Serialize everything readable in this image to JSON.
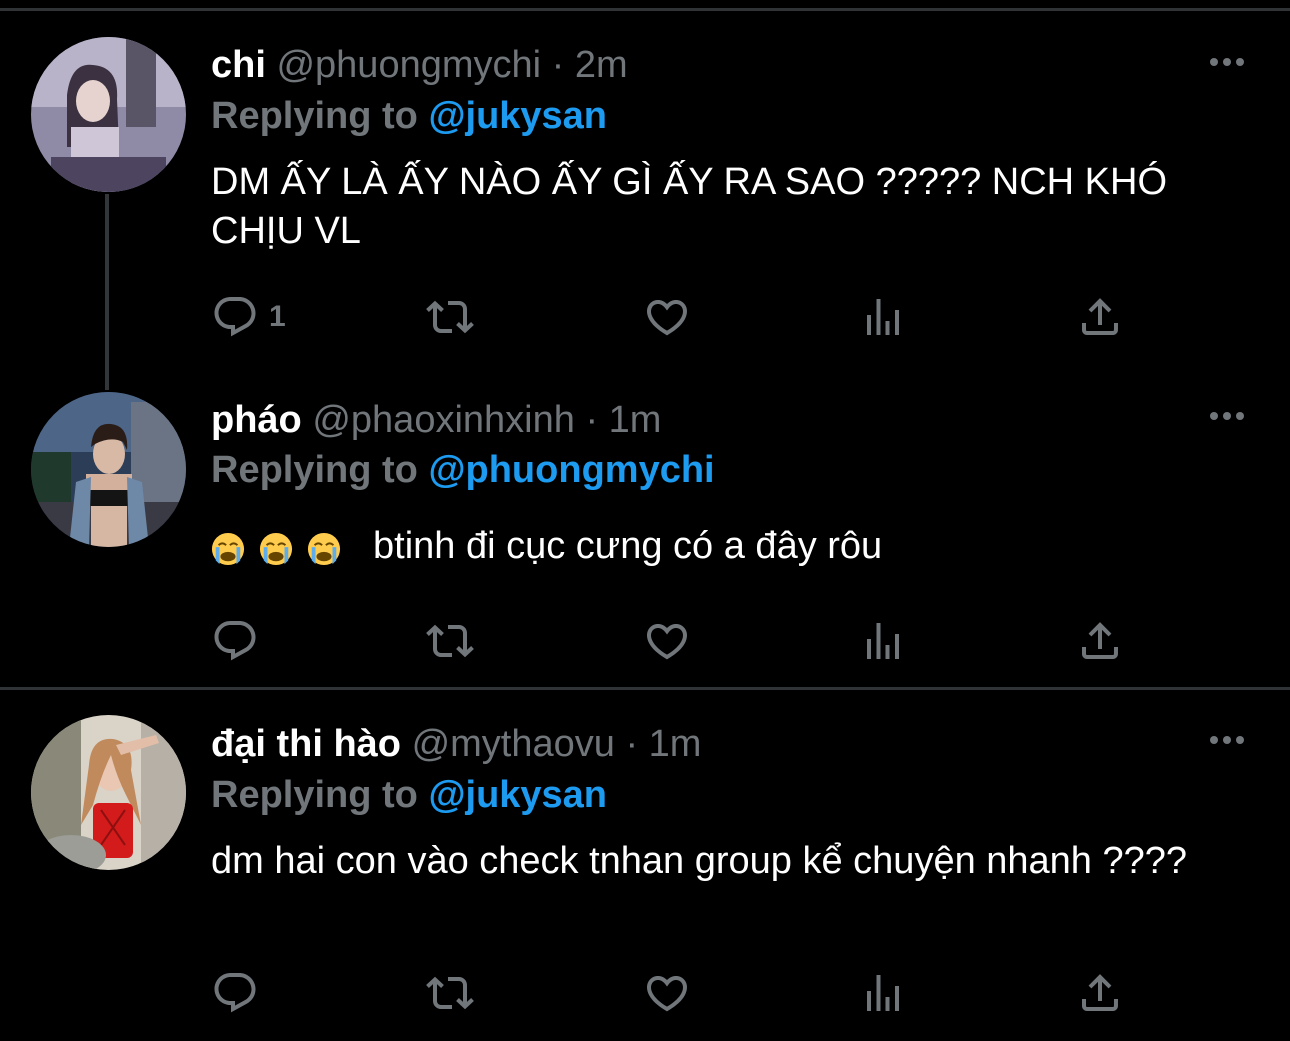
{
  "tweets": [
    {
      "name": "chi",
      "handle": "@phuongmychi",
      "separator": "·",
      "time": "2m",
      "replying_label": "Replying to",
      "replying_to": "@jukysan",
      "text": "DM ẤY LÀ ẤY NÀO ẤY GÌ ẤY RA SAO ????? NCH KHÓ CHỊU VL",
      "reply_count": "1",
      "avatar_icon": "avatar-photo"
    },
    {
      "name": "pháo",
      "handle": "@phaoxinhxinh",
      "separator": "·",
      "time": "1m",
      "replying_label": "Replying to",
      "replying_to": "@phuongmychi",
      "emojis": [
        "loudly-crying-face",
        "loudly-crying-face",
        "loudly-crying-face"
      ],
      "text": "btinh đi cục cưng có a đây rôu",
      "avatar_icon": "avatar-photo"
    },
    {
      "name": "đại thi hào",
      "handle": "@mythaovu",
      "separator": "·",
      "time": "1m",
      "replying_label": "Replying to",
      "replying_to": "@jukysan",
      "text": "dm hai con vào check tnhan group kể chuyện nhanh ????",
      "avatar_icon": "avatar-photo"
    }
  ],
  "colors": {
    "background": "#000000",
    "primary_text": "#ffffff",
    "secondary_text": "#71767b",
    "accent": "#1d9bf0",
    "divider": "#2f3336"
  }
}
